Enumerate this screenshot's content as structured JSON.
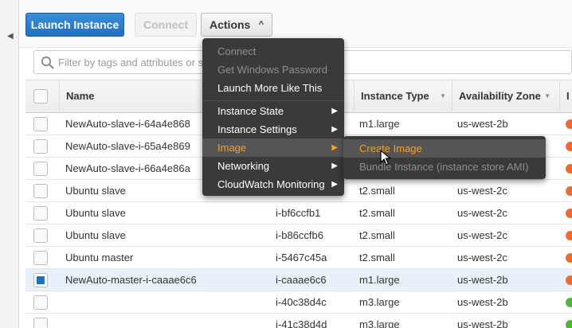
{
  "toolbar": {
    "launch_label": "Launch Instance",
    "connect_label": "Connect",
    "actions_label": "Actions",
    "actions_caret": "^"
  },
  "filter": {
    "placeholder": "Filter by tags and attributes or s"
  },
  "table": {
    "columns": [
      {
        "label": "Name"
      },
      {
        "label": "Instance Type"
      },
      {
        "label": "Availability Zone"
      },
      {
        "label": "I"
      }
    ],
    "rows": [
      {
        "name": "NewAuto-slave-i-64a4e868",
        "instance_id": "",
        "type": "m1.large",
        "zone": "us-west-2b",
        "status_color": "#ef6b2e",
        "selected": false
      },
      {
        "name": "NewAuto-slave-i-65a4e869",
        "instance_id": "",
        "type": "",
        "zone": "",
        "status_color": "#ef6b2e",
        "selected": false
      },
      {
        "name": "NewAuto-slave-i-66a4e86a",
        "instance_id": "",
        "type": "",
        "zone": "",
        "status_color": "#ef6b2e",
        "selected": false
      },
      {
        "name": "Ubuntu slave",
        "instance_id": "",
        "type": "t2.small",
        "zone": "us-west-2c",
        "status_color": "#ef6b2e",
        "selected": false
      },
      {
        "name": "Ubuntu slave",
        "instance_id": "i-bf6ccfb1",
        "type": "t2.small",
        "zone": "us-west-2c",
        "status_color": "#ef6b2e",
        "selected": false
      },
      {
        "name": "Ubuntu slave",
        "instance_id": "i-b86ccfb6",
        "type": "t2.small",
        "zone": "us-west-2c",
        "status_color": "#ef6b2e",
        "selected": false
      },
      {
        "name": "Ubuntu master",
        "instance_id": "i-5467c45a",
        "type": "t2.small",
        "zone": "us-west-2c",
        "status_color": "#ef6b2e",
        "selected": false
      },
      {
        "name": "NewAuto-master-i-caaae6c6",
        "instance_id": "i-caaae6c6",
        "type": "m1.large",
        "zone": "us-west-2b",
        "status_color": "#ef6b2e",
        "selected": true
      },
      {
        "name": "",
        "instance_id": "i-40c38d4c",
        "type": "m3.large",
        "zone": "us-west-2b",
        "status_color": "#4cb83a",
        "selected": false
      },
      {
        "name": "",
        "instance_id": "i-41c38d4d",
        "type": "m3.large",
        "zone": "us-west-2b",
        "status_color": "#4cb83a",
        "selected": false
      }
    ]
  },
  "actions_menu": {
    "items": [
      {
        "label": "Connect",
        "disabled": true,
        "submenu": false
      },
      {
        "label": "Get Windows Password",
        "disabled": true,
        "submenu": false
      },
      {
        "label": "Launch More Like This",
        "disabled": false,
        "submenu": false
      },
      {
        "label": "Instance State",
        "disabled": false,
        "submenu": true
      },
      {
        "label": "Instance Settings",
        "disabled": false,
        "submenu": true
      },
      {
        "label": "Image",
        "disabled": false,
        "submenu": true,
        "highlighted": true
      },
      {
        "label": "Networking",
        "disabled": false,
        "submenu": true
      },
      {
        "label": "CloudWatch Monitoring",
        "disabled": false,
        "submenu": true
      }
    ]
  },
  "image_submenu": {
    "items": [
      {
        "label": "Create Image",
        "disabled": false,
        "highlighted": true
      },
      {
        "label": "Bundle Instance (instance store AMI)",
        "disabled": true
      }
    ]
  },
  "colors": {
    "primary_button": "#1f6fbf",
    "menu_bg": "#3a3a3a",
    "menu_highlight_text": "#f0a030",
    "status_stopped": "#ef6b2e",
    "status_running": "#4cb83a",
    "selected_row": "#e8f1fb"
  },
  "icons": {
    "filter": "search-icon",
    "panel_toggle": "chevron-left-icon",
    "submenu_arrow": "triangle-right-icon",
    "sort": "triangle-down-icon",
    "cursor": "mouse-pointer-icon"
  }
}
